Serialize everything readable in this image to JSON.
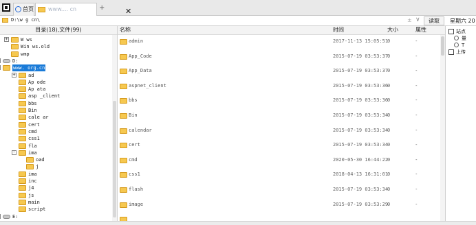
{
  "tabs": {
    "home_label": "首页",
    "active_label": "www.... cn",
    "active_suffix": "cn",
    "close_glyph": "✕",
    "new_tab_glyph": "+"
  },
  "address": {
    "path": "D:\\w          g cn\\",
    "clear_glyph": "±",
    "dropdown_glyph": "∨",
    "read_button": "读取",
    "date": "星期六 20"
  },
  "tree": {
    "header": "目录(18),文件(99)",
    "nodes": [
      {
        "label": "W   ws",
        "expander": "+",
        "icon": "folder-icon",
        "selected": false
      },
      {
        "label": "Win   ws.old",
        "expander": "",
        "icon": "folder-icon",
        "selected": false
      },
      {
        "label": "wmp",
        "expander": "",
        "icon": "folder-icon",
        "selected": false
      },
      {
        "label": "D:",
        "expander": "-",
        "icon": "drive-icon",
        "selected": false
      },
      {
        "label": "www.   org.cn",
        "expander": "-",
        "icon": "folder-icon",
        "selected": true
      },
      {
        "label": "ad",
        "expander": "+",
        "icon": "folder-icon",
        "selected": false
      },
      {
        "label": "Ap   ode",
        "expander": "",
        "icon": "folder-icon",
        "selected": false
      },
      {
        "label": "Ap   ata",
        "expander": "",
        "icon": "folder-icon",
        "selected": false
      },
      {
        "label": "asp   _client",
        "expander": "",
        "icon": "folder-icon",
        "selected": false
      },
      {
        "label": "bbs",
        "expander": "",
        "icon": "folder-icon",
        "selected": false
      },
      {
        "label": "Bin",
        "expander": "",
        "icon": "folder-icon",
        "selected": false
      },
      {
        "label": "cale   ar",
        "expander": "",
        "icon": "folder-icon",
        "selected": false
      },
      {
        "label": "cert",
        "expander": "",
        "icon": "folder-icon",
        "selected": false
      },
      {
        "label": "cmd",
        "expander": "",
        "icon": "folder-icon",
        "selected": false
      },
      {
        "label": "css1",
        "expander": "",
        "icon": "folder-icon",
        "selected": false
      },
      {
        "label": "fla",
        "expander": "",
        "icon": "folder-icon",
        "selected": false
      },
      {
        "label": "ima",
        "expander": "-",
        "icon": "folder-icon",
        "selected": false
      },
      {
        "label": "   oad",
        "expander": "",
        "icon": "folder-icon",
        "selected": false
      },
      {
        "label": "   j",
        "expander": "",
        "icon": "folder-icon",
        "selected": false
      },
      {
        "label": "ima",
        "expander": "",
        "icon": "folder-icon",
        "selected": false
      },
      {
        "label": "inc",
        "expander": "",
        "icon": "folder-icon",
        "selected": false
      },
      {
        "label": "j4",
        "expander": "",
        "icon": "folder-icon",
        "selected": false
      },
      {
        "label": "js",
        "expander": "",
        "icon": "folder-icon",
        "selected": false
      },
      {
        "label": "main",
        "expander": "",
        "icon": "folder-icon",
        "selected": false
      },
      {
        "label": "script",
        "expander": "",
        "icon": "folder-icon",
        "selected": false
      },
      {
        "label": "E:",
        "expander": "+",
        "icon": "drive-icon",
        "selected": false
      }
    ]
  },
  "list": {
    "columns": {
      "name": "名称",
      "time": "时间",
      "size": "大小",
      "attr": "属性"
    },
    "rows": [
      {
        "name": "admin",
        "time": "2017-11-13 15:05:51",
        "size": "0",
        "attr": "-"
      },
      {
        "name": "App_Code",
        "time": "2015-07-19 03:53:37",
        "size": "0",
        "attr": "-"
      },
      {
        "name": "App_Data",
        "time": "2015-07-19 03:53:37",
        "size": "0",
        "attr": "-"
      },
      {
        "name": "aspnet_client",
        "time": "2015-07-19 03:53:36",
        "size": "0",
        "attr": "-"
      },
      {
        "name": "bbs",
        "time": "2015-07-19 03:53:36",
        "size": "0",
        "attr": "-"
      },
      {
        "name": "Bin",
        "time": "2015-07-19 03:53:34",
        "size": "0",
        "attr": "-"
      },
      {
        "name": "calendar",
        "time": "2015-07-19 03:53:34",
        "size": "0",
        "attr": "-"
      },
      {
        "name": "cert",
        "time": "2015-07-19 03:53:34",
        "size": "0",
        "attr": "-"
      },
      {
        "name": "cmd",
        "time": "2020-05-30 16:44:22",
        "size": "0",
        "attr": "-"
      },
      {
        "name": "css1",
        "time": "2018-04-13 16:31:01",
        "size": "0",
        "attr": "-"
      },
      {
        "name": "flash",
        "time": "2015-07-19 03:53:34",
        "size": "0",
        "attr": "-"
      },
      {
        "name": "image",
        "time": "2015-07-19 03:53:29",
        "size": "0",
        "attr": "-"
      },
      {
        "name": "",
        "time": "",
        "size": "",
        "attr": ""
      }
    ]
  },
  "right_pane": {
    "items": [
      {
        "label": "站点",
        "kind": "checkbox"
      },
      {
        "label": "量",
        "kind": "radio"
      },
      {
        "label": "T",
        "kind": "radio"
      },
      {
        "label": "上传",
        "kind": "checkbox"
      }
    ]
  },
  "colors": {
    "folder": "#f6c850",
    "selection": "#1a7bd8",
    "header_bg": "#f3f3f3"
  }
}
